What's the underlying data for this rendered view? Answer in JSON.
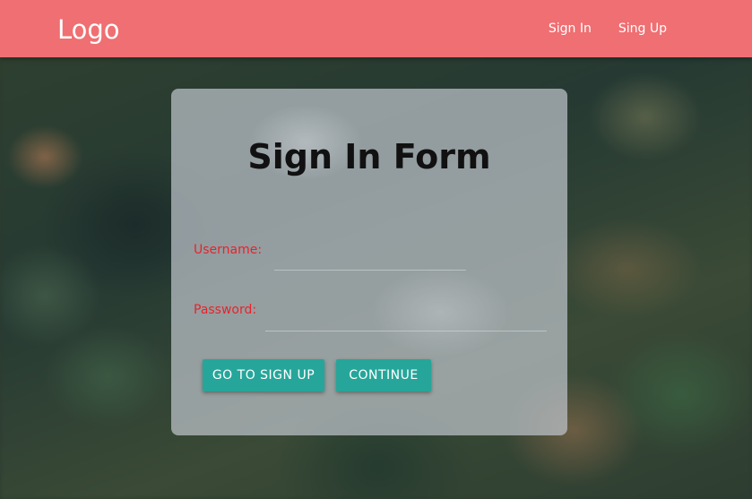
{
  "navbar": {
    "logo": "Logo",
    "links": [
      "Sign In",
      "Sing Up"
    ],
    "color": "#ef6f72"
  },
  "form": {
    "title": "Sign In Form",
    "username_label": "Username:",
    "username_value": "",
    "password_label": "Password:",
    "password_value": "",
    "label_color": "#e8232b",
    "buttons": {
      "signup": "GO TO SIGN UP",
      "continue": "CONTINUE"
    },
    "button_color": "#26a69a"
  }
}
